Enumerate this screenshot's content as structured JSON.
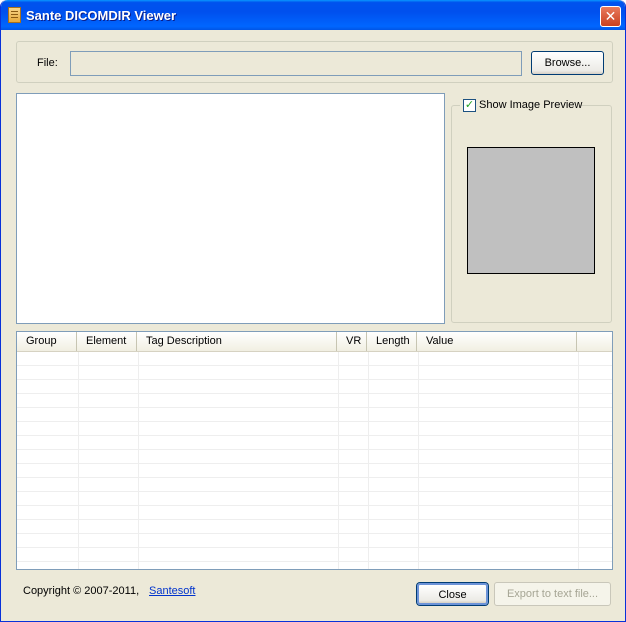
{
  "window": {
    "title": "Sante DICOMDIR Viewer",
    "close_glyph": "✕"
  },
  "file": {
    "label": "File:",
    "value": "",
    "browse_label": "Browse..."
  },
  "preview": {
    "checkbox_label": "Show Image Preview",
    "checked": true,
    "check_glyph": "✓"
  },
  "table": {
    "columns": [
      "Group",
      "Element",
      "Tag Description",
      "VR",
      "Length",
      "Value"
    ],
    "rows": []
  },
  "footer": {
    "copyright": "Copyright © 2007-2011,",
    "company_link": "Santesoft",
    "close_label": "Close",
    "export_label": "Export to text file..."
  },
  "colors": {
    "titlebar": "#0053ee",
    "face": "#ece9d8",
    "check": "#21a121",
    "link": "#0033cc"
  }
}
